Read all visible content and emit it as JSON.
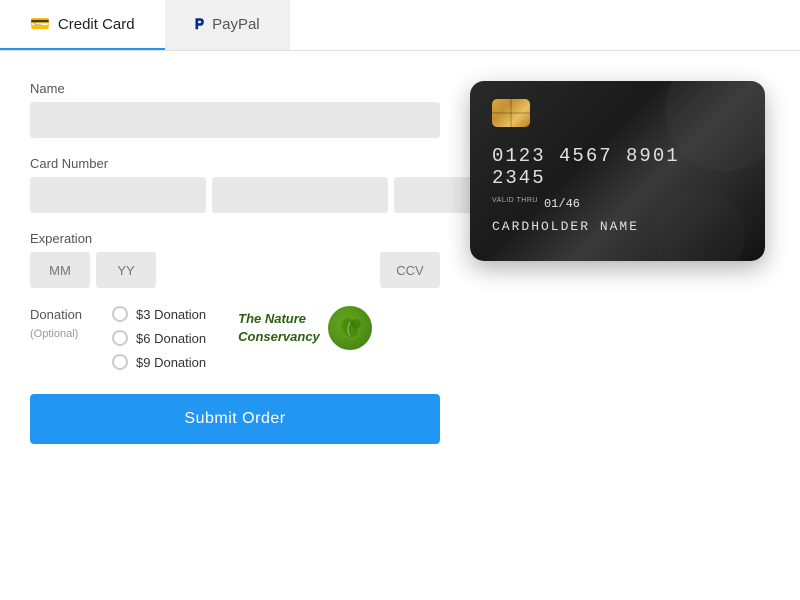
{
  "tabs": [
    {
      "label": "Credit Card",
      "icon": "💳",
      "active": true
    },
    {
      "label": "PayPal",
      "icon": "P",
      "active": false
    }
  ],
  "form": {
    "name_label": "Name",
    "name_placeholder": "",
    "card_number_label": "Card Number",
    "card_seg1": "",
    "card_seg2": "",
    "card_seg3": "",
    "card_seg4": "",
    "expiration_label": "Experation",
    "mm_placeholder": "MM",
    "yy_placeholder": "YY",
    "ccv_placeholder": "CCV",
    "donation_label": "Donation",
    "donation_optional": "(Optional)",
    "donation_options": [
      {
        "label": "$3 Donation",
        "value": "3"
      },
      {
        "label": "$6 Donation",
        "value": "6"
      },
      {
        "label": "$9 Donation",
        "value": "9"
      }
    ],
    "submit_label": "Submit Order"
  },
  "nature_conservancy": {
    "name_line1": "The Nature",
    "name_line2": "Conservancy"
  },
  "card_visual": {
    "number": "0123 4567 8901 2345",
    "valid_thru_label": "VALID THRU",
    "valid_date": "01/46",
    "holder_name": "CARDHOLDER  NAME"
  }
}
